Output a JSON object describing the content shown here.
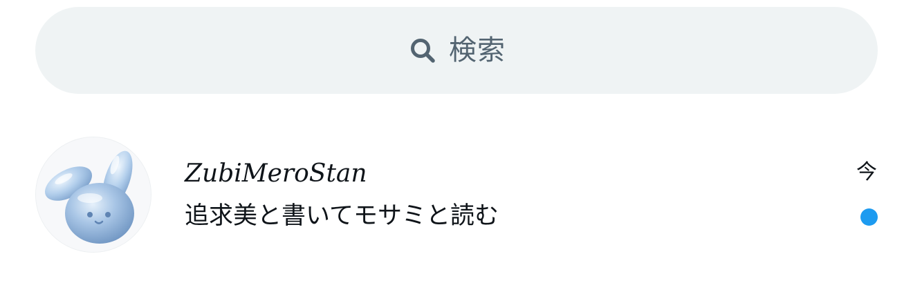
{
  "search": {
    "placeholder": "検索",
    "icon": "search-icon"
  },
  "conversation": {
    "display_name": "ZubiMeroStan",
    "preview": "追求美と書いてモサミと読む",
    "timestamp": "今",
    "unread": true,
    "avatar_icon": "bunny-avatar-icon"
  },
  "colors": {
    "search_bg": "#eff3f4",
    "search_text": "#536471",
    "unread_dot": "#1d9bf0",
    "text_primary": "#0f1419"
  }
}
